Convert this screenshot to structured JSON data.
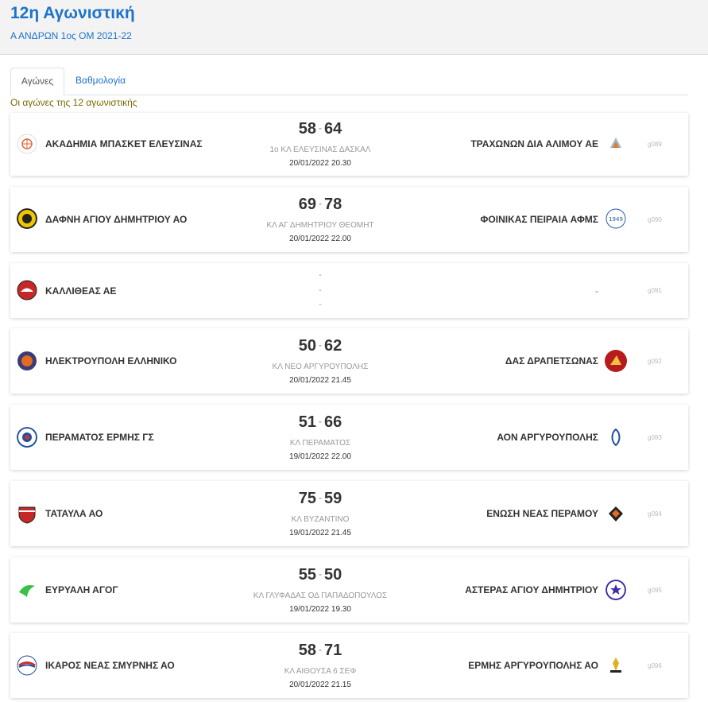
{
  "header": {
    "title": "12η Αγωνιστική",
    "subtitle": "Α ΑΝΔΡΩΝ 1ος ΟΜ 2021-22"
  },
  "tabs": [
    {
      "label": "Αγώνες",
      "active": true
    },
    {
      "label": "Βαθμολογία",
      "active": false
    }
  ],
  "round_caption": "Οι αγώνες της 12 αγωνιστικής",
  "matches": [
    {
      "home": "ΑΚΑΔΗΜΙΑ ΜΠΑΣΚΕΤ ΕΛΕΥΣΙΝΑΣ",
      "home_score": "58",
      "away_score": "64",
      "venue": "1ο ΚΛ ΕΛΕΥΣΙΝΑΣ ΔΑΣΚΑΛ",
      "datetime": "20/01/2022 20.30",
      "away": "ΤΡΑΧΩΝΩΝ ΔΙΑ ΑΛΙΜΟΥ ΑΕ",
      "code": "g089"
    },
    {
      "home": "ΔΑΦΝΗ ΑΓΙΟΥ ΔΗΜΗΤΡΙΟΥ ΑΟ",
      "home_score": "69",
      "away_score": "78",
      "venue": "ΚΛ ΑΓ ΔΗΜΗΤΡΙΟΥ ΘΕΟΜΗΤ",
      "datetime": "20/01/2022 22.00",
      "away": "ΦΟΙΝΙΚΑΣ ΠΕΙΡΑΙΑ ΑΦΜΣ",
      "code": "g090"
    },
    {
      "home": "ΚΑΛΛΙΘΕΑΣ ΑΕ",
      "placeholder_1": "-",
      "placeholder_2": "-",
      "placeholder_3": "-",
      "away_placeholder": "-",
      "code": "g091"
    },
    {
      "home": "ΗΛΕΚΤΡΟΥΠΟΛΗ ΕΛΛΗΝΙΚΟ",
      "home_score": "50",
      "away_score": "62",
      "venue": "ΚΛ ΝΕΟ ΑΡΓΥΡΟΥΠΟΛΗΣ",
      "datetime": "20/01/2022 21.45",
      "away": "ΔΑΣ ΔΡΑΠΕΤΣΩΝΑΣ",
      "code": "g092"
    },
    {
      "home": "ΠΕΡΑΜΑΤΟΣ ΕΡΜΗΣ ΓΣ",
      "home_score": "51",
      "away_score": "66",
      "venue": "ΚΛ ΠΕΡΑΜΑΤΟΣ",
      "datetime": "19/01/2022 22.00",
      "away": "ΑΟΝ ΑΡΓΥΡΟΥΠΟΛΗΣ",
      "code": "g093"
    },
    {
      "home": "ΤΑΤΑΥΛΑ ΑΟ",
      "home_score": "75",
      "away_score": "59",
      "venue": "ΚΛ ΒΥΖΑΝΤΙΝΟ",
      "datetime": "19/01/2022 21.45",
      "away": "ΕΝΩΣΗ ΝΕΑΣ ΠΕΡΑΜΟΥ",
      "code": "g094"
    },
    {
      "home": "ΕΥΡΥΑΛΗ ΑΓΟΓ",
      "home_score": "55",
      "away_score": "50",
      "venue": "ΚΛ ΓΛΥΦΑΔΑΣ ΟΔ ΠΑΠΑΔΟΠΟΥΛΟΣ",
      "datetime": "19/01/2022 19.30",
      "away": "ΑΣΤΕΡΑΣ ΑΓΙΟΥ ΔΗΜΗΤΡΙΟΥ",
      "code": "g095"
    },
    {
      "home": "ΙΚΑΡΟΣ ΝΕΑΣ ΣΜΥΡΝΗΣ ΑΟ",
      "home_score": "58",
      "away_score": "71",
      "venue": "ΚΛ ΑΙΘΟΥΣΑ 6 ΣΕΦ",
      "datetime": "20/01/2022 21.15",
      "away": "ΕΡΜΗΣ ΑΡΓΥΡΟΥΠΟΛΗΣ ΑΟ",
      "code": "g096"
    }
  ],
  "colors": {
    "accent": "#1d73c9",
    "caption": "#7a6a00"
  }
}
